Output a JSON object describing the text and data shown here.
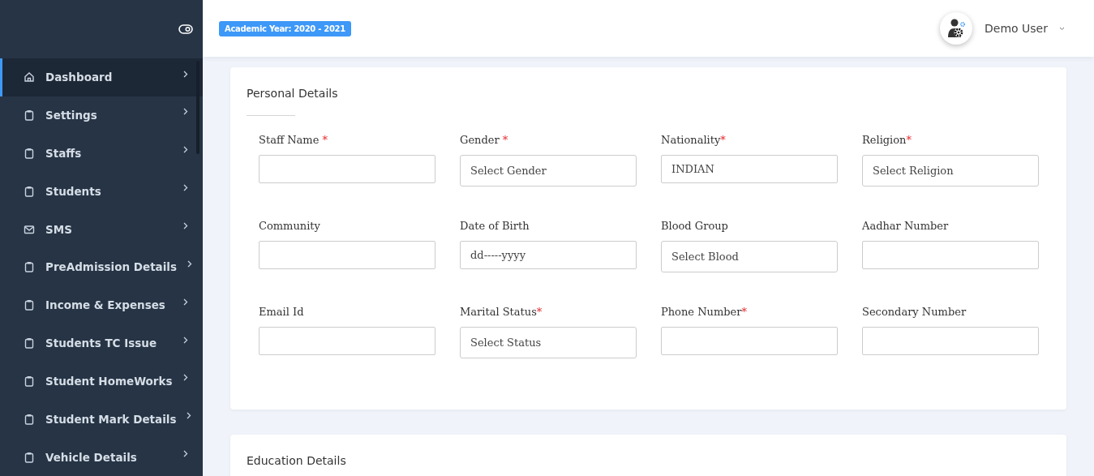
{
  "sidebar": {
    "items": [
      {
        "label": "Dashboard",
        "kind": "home",
        "selected": true
      },
      {
        "label": "Settings",
        "kind": "clipboard",
        "selected": false
      },
      {
        "label": "Staffs",
        "kind": "clipboard",
        "selected": false
      },
      {
        "label": "Students",
        "kind": "clipboard",
        "selected": false
      },
      {
        "label": "SMS",
        "kind": "mail",
        "selected": false
      },
      {
        "label": "PreAdmission Details",
        "kind": "clipboard",
        "selected": false
      },
      {
        "label": "Income & Expenses",
        "kind": "clipboard",
        "selected": false
      },
      {
        "label": "Students TC Issue",
        "kind": "clipboard",
        "selected": false
      },
      {
        "label": "Student HomeWorks",
        "kind": "clipboard",
        "selected": false
      },
      {
        "label": "Student Mark Details",
        "kind": "clipboard",
        "selected": false
      },
      {
        "label": "Vehicle Details",
        "kind": "clipboard",
        "selected": false
      }
    ]
  },
  "header": {
    "badge": "Academic Year: 2020 - 2021",
    "user": "Demo User"
  },
  "sections": [
    {
      "title": "Personal Details",
      "fields": [
        {
          "label": "Staff Name",
          "required": " *",
          "kind": "input"
        },
        {
          "label": "Gender",
          "required": " *",
          "kind": "select",
          "value": "Select Gender"
        },
        {
          "label": "Nationality",
          "required": "*",
          "kind": "input",
          "value": "INDIAN"
        },
        {
          "label": "Religion",
          "required": "*",
          "kind": "select",
          "value": "Select Religion"
        },
        {
          "label": "Community",
          "kind": "input"
        },
        {
          "label": "Date of Birth",
          "kind": "date",
          "value": "dd-----yyyy"
        },
        {
          "label": "Blood Group",
          "kind": "select",
          "value": "Select Blood"
        },
        {
          "label": "Aadhar Number",
          "kind": "input"
        },
        {
          "label": "Email Id",
          "kind": "input"
        },
        {
          "label": "Marital Status",
          "required": "*",
          "kind": "select",
          "value": "Select Status"
        },
        {
          "label": "Phone Number",
          "required": "*",
          "kind": "input"
        },
        {
          "label": "Secondary Number",
          "kind": "input"
        }
      ]
    },
    {
      "title": "Education Details"
    }
  ]
}
